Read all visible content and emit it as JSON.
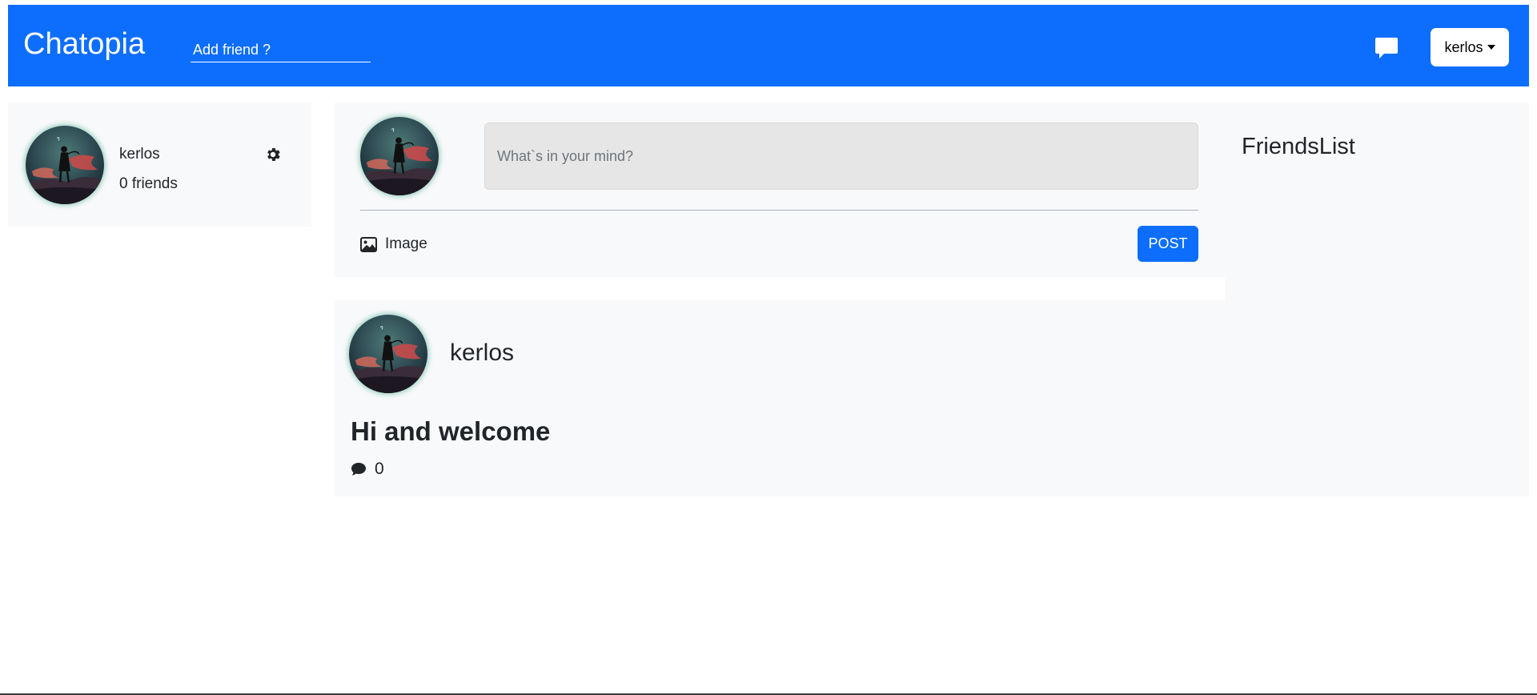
{
  "header": {
    "brand": "Chatopia",
    "add_friend_placeholder": "Add friend ?",
    "user_menu_label": "kerlos",
    "brand_color": "#0d6efd",
    "chat_icon": "speech-bubble-icon"
  },
  "profile": {
    "name": "kerlos",
    "friends_count": "0 friends",
    "settings_icon": "gear-icon"
  },
  "composer": {
    "placeholder": "What`s in your mind?",
    "image_label": "Image",
    "post_label": "POST",
    "image_icon": "image-icon"
  },
  "friends_list": {
    "title": "FriendsList"
  },
  "post": {
    "author": "kerlos",
    "text": "Hi and welcome",
    "comment_count": "0",
    "comment_icon": "comment-icon"
  }
}
